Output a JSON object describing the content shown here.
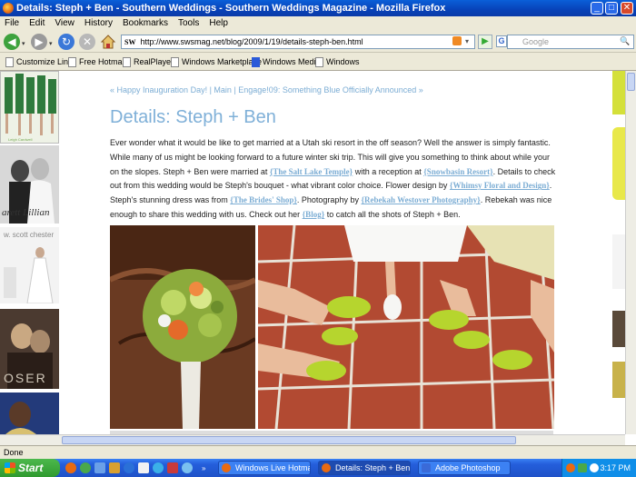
{
  "window": {
    "title": "Details: Steph + Ben - Southern Weddings - Southern Weddings Magazine - Mozilla Firefox",
    "min": "_",
    "max": "□",
    "close": "✕"
  },
  "menu": [
    "File",
    "Edit",
    "View",
    "History",
    "Bookmarks",
    "Tools",
    "Help"
  ],
  "nav": {
    "url": "http://www.swsmag.net/blog/2009/1/19/details-steph-ben.html",
    "site_badge": "SW",
    "search_placeholder": "Google",
    "search_engine_label": "G"
  },
  "bookmarks": [
    "Customize Links",
    "Free Hotmail",
    "RealPlayer",
    "Windows Marketplace",
    "Windows Media",
    "Windows"
  ],
  "post": {
    "nav_prev": "« Happy Inauguration Day!",
    "nav_sep1": " | ",
    "nav_main": "Main",
    "nav_sep2": " | ",
    "nav_next": "Engage!09: Something Blue Officially Announced »",
    "title": "Details: Steph + Ben",
    "body": [
      {
        "t": "text",
        "v": "Ever wonder what it would be like to get married at a Utah ski resort in the off season? Well the answer is simply fantastic. While many of us might be looking forward to a future winter ski trip. This will give you something to think about while your on the slopes. Steph + Ben were married at "
      },
      {
        "t": "link",
        "v": "{The Salt Lake Temple}"
      },
      {
        "t": "text",
        "v": " with a reception at "
      },
      {
        "t": "link",
        "v": "{Snowbasin Resort}"
      },
      {
        "t": "text",
        "v": ". Details to check out from this wedding would be Steph's bouquet - what vibrant color choice.  Flower design by "
      },
      {
        "t": "link",
        "v": "{Whimsy Floral and Design}"
      },
      {
        "t": "text",
        "v": ".  Steph's stunning dress was from "
      },
      {
        "t": "link",
        "v": "{The Brides' Shop}"
      },
      {
        "t": "text",
        "v": ".  Photography by "
      },
      {
        "t": "link",
        "v": "{Rebekah Westover Photography}"
      },
      {
        "t": "text",
        "v": ".  Rebekah was nice enough to share this wedding with us.  Check out her "
      },
      {
        "t": "link",
        "v": "{Blog}"
      },
      {
        "t": "text",
        "v": " to catch all the shots of Steph + Ben."
      }
    ]
  },
  "sidebar_left": {
    "thumb2_caption": "arett Lillian",
    "thumb3_caption": "w. scott chester",
    "thumb4_caption": "OSER"
  },
  "status": "Done",
  "taskbar": {
    "start": "Start",
    "tasks": [
      "Windows Live Hotmail...",
      "Details: Steph + Ben ...",
      "Adobe Photoshop"
    ],
    "clock": "3:17 PM"
  },
  "colors": {
    "link": "#7cadd4",
    "title": "#7fb0d8",
    "body_text": "#222222",
    "accent_green": "#b6d52e"
  }
}
